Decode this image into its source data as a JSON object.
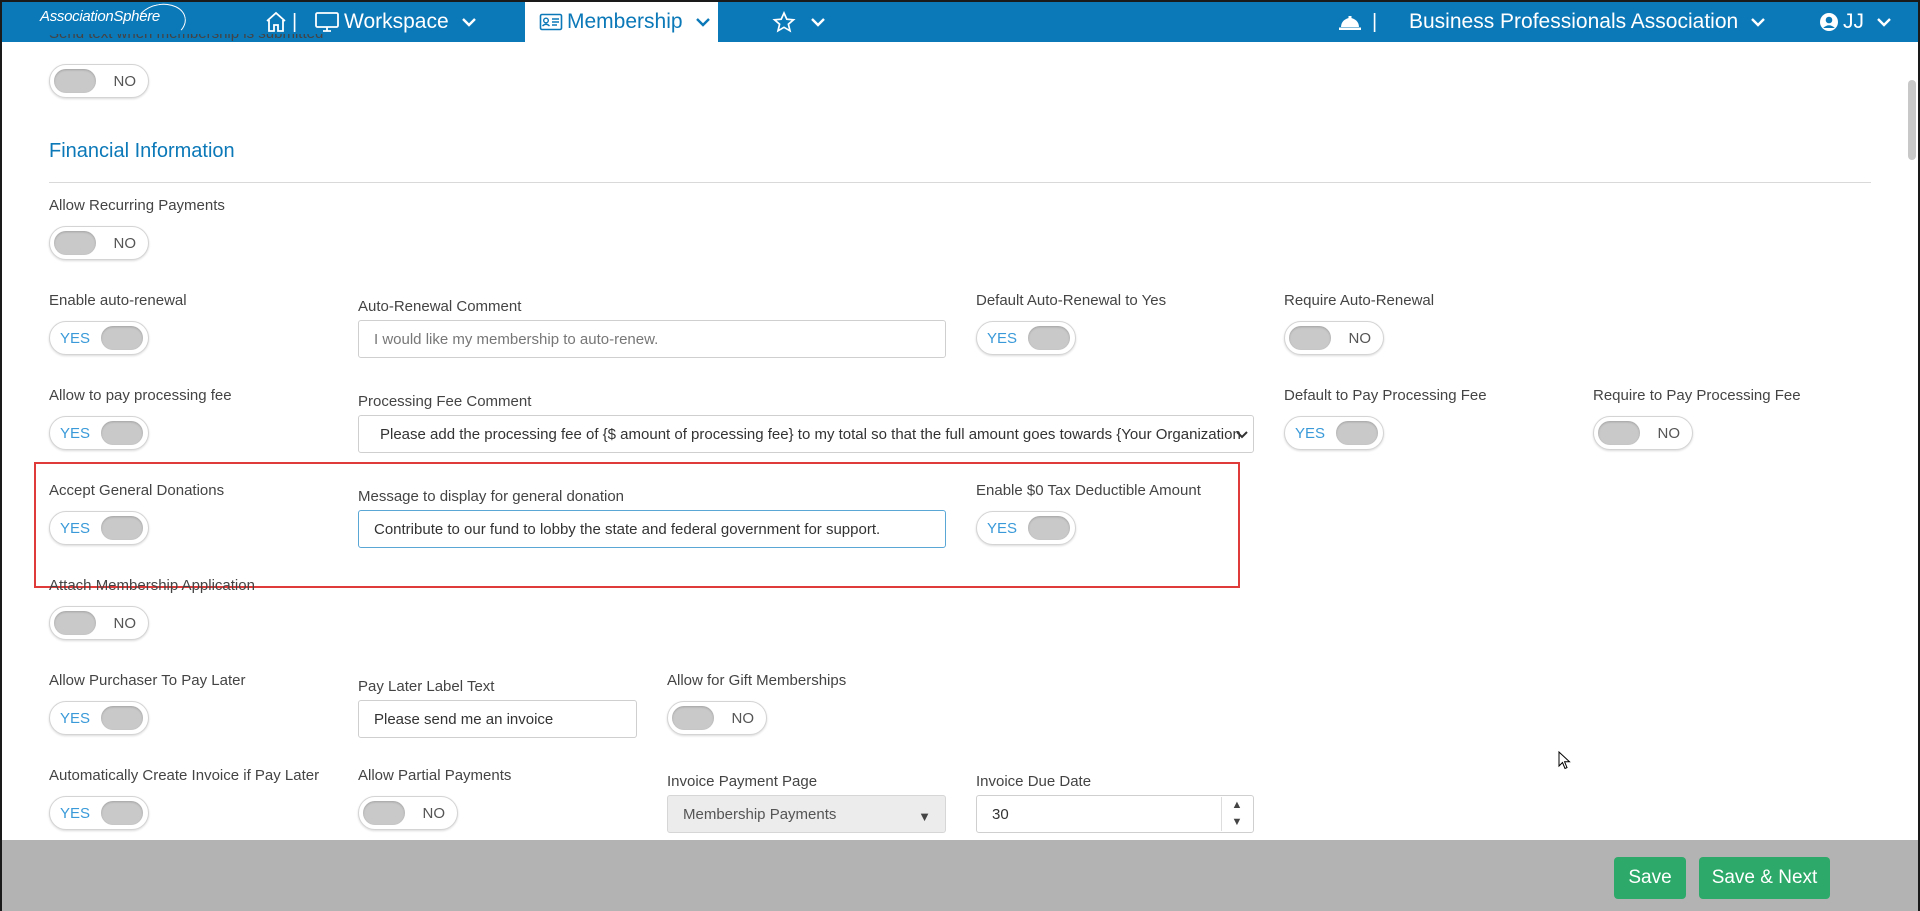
{
  "topbar": {
    "logo_text": "AssociationSphere",
    "sep": "|",
    "workspace_label": "Workspace",
    "membership_label": "Membership",
    "org_name": "Business Professionals Association",
    "user_initials": "JJ",
    "brand_color": "#0b78b8"
  },
  "form": {
    "send_text_label": "Send text when membership is submitted",
    "send_text_toggle": "NO",
    "section_title": "Financial Information",
    "allow_recurring_label": "Allow Recurring Payments",
    "allow_recurring_toggle": "NO",
    "enable_auto_renewal_label": "Enable auto-renewal",
    "enable_auto_renewal_toggle": "YES",
    "auto_renewal_comment_label": "Auto-Renewal Comment",
    "auto_renewal_comment_placeholder": "I would like my membership to auto-renew.",
    "default_auto_renewal_label": "Default Auto-Renewal to Yes",
    "default_auto_renewal_toggle": "YES",
    "require_auto_renewal_label": "Require Auto-Renewal",
    "require_auto_renewal_toggle": "NO",
    "allow_processing_fee_label": "Allow to pay processing fee",
    "allow_processing_fee_toggle": "YES",
    "processing_fee_comment_label": "Processing Fee Comment",
    "processing_fee_comment_value": "Please add the processing fee of {$ amount of processing fee} to my total so that the full amount goes towards {Your Organization",
    "default_processing_fee_label": "Default to Pay Processing Fee",
    "default_processing_fee_toggle": "YES",
    "require_processing_fee_label": "Require to Pay Processing Fee",
    "require_processing_fee_toggle": "NO",
    "accept_donations_label": "Accept General Donations",
    "accept_donations_toggle": "YES",
    "donation_message_label": "Message to display for general donation",
    "donation_message_value": "Contribute to our fund to lobby the state and federal government for support.",
    "tax_deductible_label": "Enable $0 Tax Deductible Amount",
    "tax_deductible_toggle": "YES",
    "attach_application_label": "Attach Membership Application",
    "attach_application_toggle": "NO",
    "pay_later_label": "Allow Purchaser To Pay Later",
    "pay_later_toggle": "YES",
    "pay_later_text_label": "Pay Later Label Text",
    "pay_later_text_value": "Please send me an invoice",
    "gift_memberships_label": "Allow for Gift Memberships",
    "gift_memberships_toggle": "NO",
    "auto_invoice_label": "Automatically Create Invoice if Pay Later",
    "auto_invoice_toggle": "YES",
    "partial_payments_label": "Allow Partial Payments",
    "partial_payments_toggle": "NO",
    "invoice_page_label": "Invoice Payment Page",
    "invoice_page_value": "Membership Payments",
    "invoice_due_label": "Invoice Due Date",
    "invoice_due_value": "30"
  },
  "footer": {
    "save_label": "Save",
    "save_next_label": "Save & Next",
    "button_color": "#2daa6a"
  },
  "highlight_color": "#e03b3b"
}
